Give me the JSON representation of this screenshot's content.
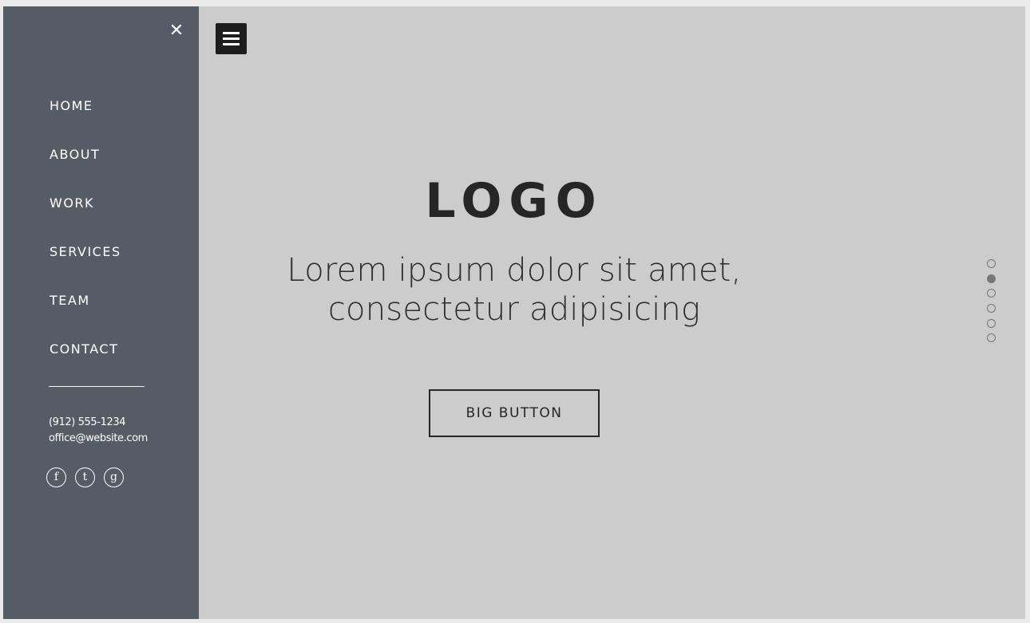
{
  "sidebar": {
    "close_glyph": "✕",
    "nav_items": [
      {
        "label": "HOME"
      },
      {
        "label": "ABOUT"
      },
      {
        "label": "WORK"
      },
      {
        "label": "SERVICES"
      },
      {
        "label": "TEAM"
      },
      {
        "label": "CONTACT"
      }
    ],
    "phone": "(912) 555-1234",
    "email": "office@website.com",
    "social": [
      {
        "glyph": "f",
        "icon": "facebook-icon"
      },
      {
        "glyph": "t",
        "icon": "twitter-icon"
      },
      {
        "glyph": "g",
        "icon": "google-plus-icon"
      }
    ],
    "colors": {
      "background": "#565c66",
      "text": "#ffffff"
    }
  },
  "main": {
    "logo": "LOGO",
    "tagline_line1": "Lorem ipsum dolor sit amet,",
    "tagline_line2": "consectetur adipisicing",
    "button_label": "BIG BUTTON",
    "pagination": {
      "count": 6,
      "active_index": 1
    },
    "colors": {
      "background": "#cccccc",
      "text": "#262626"
    }
  }
}
